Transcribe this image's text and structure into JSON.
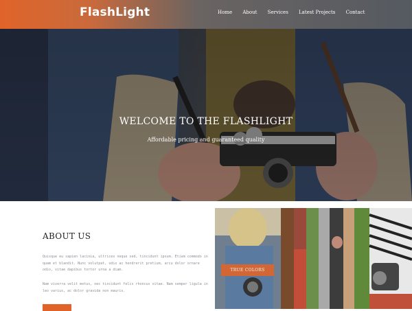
{
  "brand": "FlashLight",
  "nav": [
    "Home",
    "About",
    "Services",
    "Latest Projects",
    "Contact"
  ],
  "hero": {
    "title": "WELCOME TO THE FLASHLIGHT",
    "subtitle": "Affordable pricing and guaranteed quality"
  },
  "about": {
    "title": "ABOUT US",
    "p1": "Quisque eu sapien lacinia, ultrices neque sed, tincidunt ipsum. Etiam commodo in quam et blandit. Nunc volutpat, odio ac hendrerit pretium, arcu dolor ornare odio, vitae dapibus tortor urna a diam.",
    "p2": "Nam viverra velit metus, nec tincidunt felis rhoncus vitae. Nam semper ligula in leo varius, ac dolor gravida non mauris.",
    "button": ""
  },
  "gallery": {
    "overlay_label": "TRUE COLORS"
  },
  "colors": {
    "accent": "#e0642a",
    "header_dark": "#555a61"
  }
}
